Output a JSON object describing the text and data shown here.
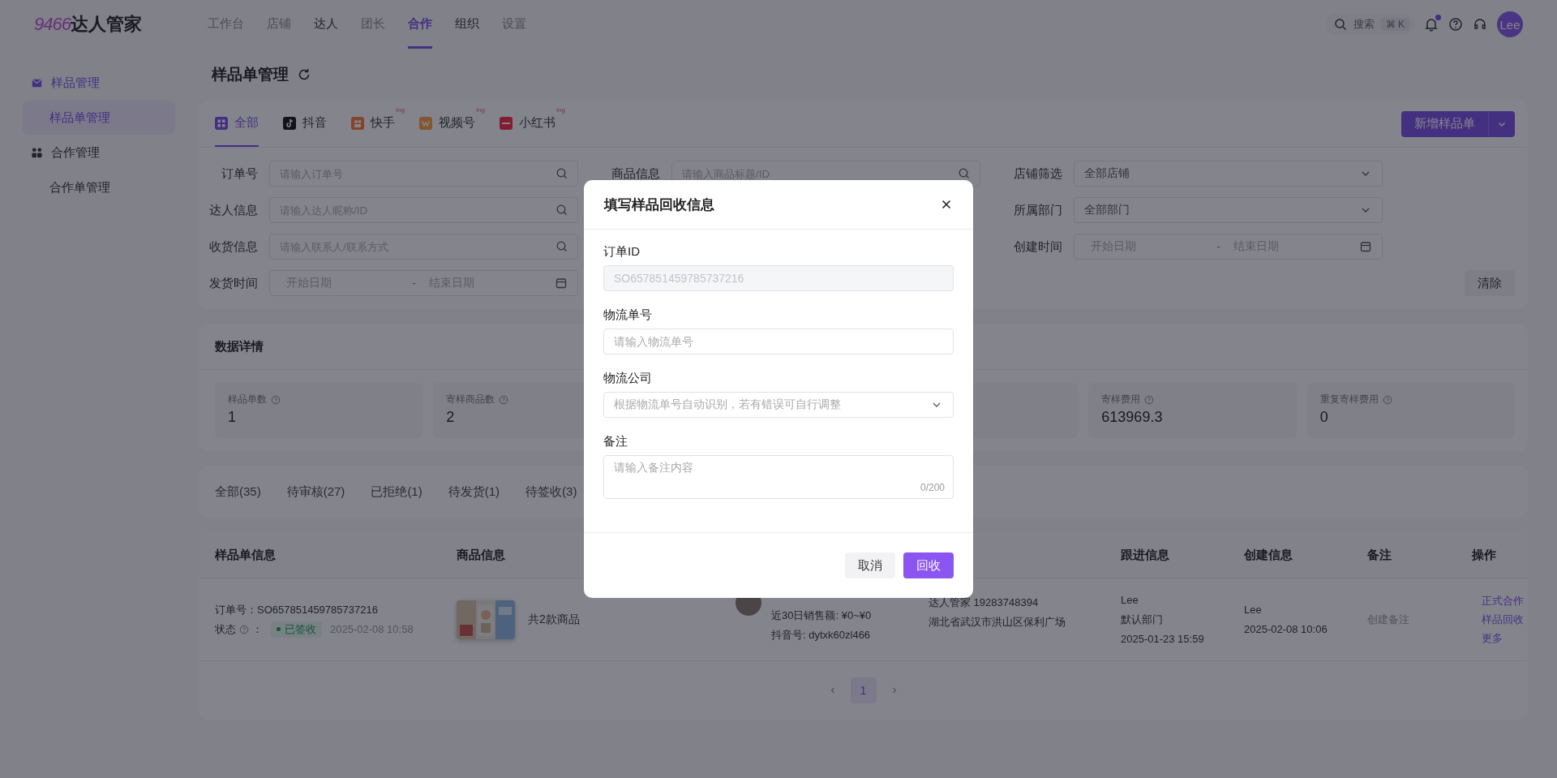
{
  "brand": {
    "number": "9466",
    "name": "达人管家"
  },
  "nav": [
    {
      "label": "工作台",
      "selected": false,
      "disabled": true
    },
    {
      "label": "店铺",
      "selected": false,
      "disabled": true
    },
    {
      "label": "达人",
      "selected": false,
      "disabled": false
    },
    {
      "label": "团长",
      "selected": false,
      "disabled": true
    },
    {
      "label": "合作",
      "selected": true,
      "disabled": false
    },
    {
      "label": "组织",
      "selected": false,
      "disabled": false
    },
    {
      "label": "设置",
      "selected": false,
      "disabled": true
    }
  ],
  "header_search": {
    "placeholder": "搜索",
    "shortcut": "⌘ K"
  },
  "notifications": {
    "unread": true
  },
  "user": {
    "avatar": "Lee"
  },
  "sidebar": [
    {
      "label": "样品管理",
      "kind": "box",
      "active": true,
      "children": [
        {
          "label": "样品单管理",
          "selected": true
        }
      ]
    },
    {
      "label": "合作管理",
      "kind": "grid",
      "active": false,
      "children": [
        {
          "label": "合作单管理",
          "selected": false
        }
      ]
    }
  ],
  "page_title": "样品单管理",
  "platform_tabs": [
    {
      "label": "全部",
      "kind": "all",
      "selected": true
    },
    {
      "label": "抖音",
      "kind": "douyin",
      "selected": false
    },
    {
      "label": "快手",
      "kind": "kuaishou",
      "selected": false,
      "badge": "ing"
    },
    {
      "label": "视频号",
      "kind": "channels",
      "selected": false,
      "badge": "ing"
    },
    {
      "label": "小红书",
      "kind": "xhs",
      "selected": false,
      "badge": "ing"
    }
  ],
  "add_button": "新增样品单",
  "filter_columns": [
    [
      {
        "label": "订单号",
        "kind": "search",
        "placeholder": "请输入订单号"
      },
      {
        "label": "达人信息",
        "kind": "search",
        "placeholder": "请输入达人昵称/ID"
      },
      {
        "label": "收货信息",
        "kind": "search",
        "placeholder": "请输入联系人/联系方式"
      },
      {
        "label": "发货时间",
        "kind": "daterange",
        "start": "开始日期",
        "separator": "-",
        "end": "结束日期"
      }
    ],
    [
      {
        "label": "商品信息",
        "kind": "search",
        "placeholder": "请输入商品标题/ID"
      }
    ],
    [
      {
        "label": "店铺筛选",
        "kind": "select",
        "value": "全部店铺"
      },
      {
        "label": "所属部门",
        "kind": "select",
        "value": "全部部门"
      },
      {
        "label": "创建时间",
        "kind": "daterange",
        "start": "开始日期",
        "separator": "-",
        "end": "结束日期"
      }
    ]
  ],
  "clear_button": "清除",
  "stats_title": "数据详情",
  "stats": [
    {
      "label": "样品单数",
      "value": "1"
    },
    {
      "label": "寄样商品数",
      "value": "2"
    },
    {
      "label": "寄样费用",
      "value": "613969.3"
    },
    {
      "label": "重复寄样费用",
      "value": "0"
    }
  ],
  "status_tabs": [
    "全部(35)",
    "待审核(27)",
    "已拒绝(1)",
    "待发货(1)",
    "待签收(3)"
  ],
  "table": {
    "columns": [
      "样品单信息",
      "商品信息",
      "跟进信息",
      "创建信息",
      "备注",
      "操作"
    ],
    "rows": [
      {
        "order_label": "订单号：",
        "order_no": "SO657851459785737216",
        "status_label": "状态",
        "status_colon": "：",
        "status": "已签收",
        "status_time": "2025-02-08 10:58",
        "product_summary": "共2款商品",
        "sales": "近30日销售额:  ¥0~¥0",
        "douyin_id": "抖音号:  dytxk60zl466",
        "receiver": "达人管家  19283748394",
        "address": "湖北省武汉市洪山区保利广场",
        "follow": [
          "Lee",
          "默认部门",
          "2025-01-23 15:59"
        ],
        "created": [
          "Lee",
          "2025-02-08 10:06"
        ],
        "remark": "创建备注",
        "actions": [
          "正式合作",
          "样品回收",
          "更多"
        ]
      }
    ]
  },
  "pagination": {
    "pages": [
      {
        "label": "1",
        "selected": true
      }
    ]
  },
  "modal": {
    "title": "填写样品回收信息",
    "fields": [
      {
        "label": "订单ID",
        "kind": "disabled",
        "value": "SO657851459785737216"
      },
      {
        "label": "物流单号",
        "kind": "input",
        "placeholder": "请输入物流单号"
      },
      {
        "label": "物流公司",
        "kind": "select",
        "placeholder": "根据物流单号自动识别，若有错误可自行调整"
      },
      {
        "label": "备注",
        "kind": "textarea",
        "placeholder": "请输入备注内容",
        "count": "0/200"
      }
    ],
    "buttons": [
      {
        "label": "取消",
        "kind": "secondary"
      },
      {
        "label": "回收",
        "kind": "primary"
      }
    ]
  }
}
